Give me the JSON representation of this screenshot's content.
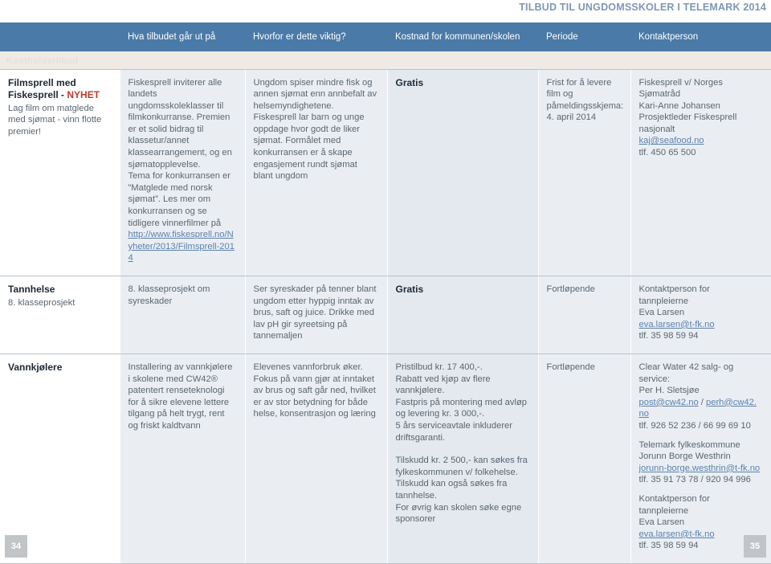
{
  "header": {
    "title": "TILBUD TIL UNGDOMSSKOLER I TELEMARK 2014",
    "accent_color": "#7e96b5"
  },
  "table": {
    "header_bg": "#4a7aa7",
    "band_text": "Kostholdstilbud",
    "columns": [
      {
        "key": "tilbud",
        "label": ""
      },
      {
        "key": "hva",
        "label": "Hva tilbudet går ut på"
      },
      {
        "key": "hvorfor",
        "label": "Hvorfor er dette viktig?"
      },
      {
        "key": "kostnad",
        "label": "Kostnad for kommunen/skolen"
      },
      {
        "key": "periode",
        "label": "Periode"
      },
      {
        "key": "kontaktperson",
        "label": "Kontaktperson"
      }
    ],
    "rows": [
      {
        "title": "Filmsprell med Fiskesprell - ",
        "title_badge": "NYHET",
        "subtitle": "Lag film om matglede med sjømat - vinn flotte premier!",
        "hva": "Fiskesprell inviterer alle landets ungdomsskoleklasser til filmkonkurranse. Premien er et solid bidrag til klassetur/annet klassearrangement, og en sjømatopplevelse.\nTema for konkurransen er ”Matglede med norsk sjømat”. Les mer om konkurransen og se tidligere vinnerfilmer på ",
        "hva_link": "http://www.fiskesprell.no/Nyheter/2013/Filmsprell-2014",
        "hvorfor": "Ungdom spiser mindre fisk og annen sjømat enn annbefalt av helsemyndighetene. Fiskesprell lar barn og unge oppdage hvor godt de liker sjømat. Formålet med konkurransen er å skape engasjement rundt sjømat blant ungdom",
        "kostnad_bold": "Gratis",
        "kostnad": "",
        "periode": "Frist for å levere film og påmeldingsskjema:\n4. april 2014",
        "kontakt_lines": [
          {
            "text": "Fiskesprell v/ Norges Sjømatråd",
            "link": false
          },
          {
            "text": "Kari-Anne Johansen",
            "link": false
          },
          {
            "text": "Prosjektleder Fiskesprell nasjonalt",
            "link": false
          },
          {
            "text": "kaj@seafood.no",
            "link": true
          },
          {
            "text": "tlf. 450 65 500",
            "link": false
          }
        ]
      },
      {
        "title": "Tannhelse",
        "title_badge": "",
        "subtitle": "8. klasseprosjekt",
        "hva": "8. klasseprosjekt om syreskader",
        "hva_link": "",
        "hvorfor": "Ser syreskader på tenner blant ungdom etter hyppig inntak av brus, saft og juice. Drikke med lav pH gir syreetsing på tannemaljen",
        "kostnad_bold": "Gratis",
        "kostnad": "",
        "periode": "Fortløpende",
        "kontakt_lines": [
          {
            "text": "Kontaktperson for tannpleierne",
            "link": false
          },
          {
            "text": "Eva Larsen",
            "link": false
          },
          {
            "text": "eva.larsen@t-fk.no",
            "link": true
          },
          {
            "text": "tlf. 35 98 59 94",
            "link": false
          }
        ]
      },
      {
        "title": "Vannkjølere",
        "title_badge": "",
        "subtitle": "",
        "hva": "Installering av vannkjølere i skolene med CW42® patentert renseteknologi for å sikre elevene lettere tilgang på helt trygt, rent og friskt kaldtvann",
        "hva_link": "",
        "hvorfor": "Elevenes vannforbruk øker. Fokus på vann gjør at inntaket av brus og saft går ned, hvilket er av stor betydning for både helse, konsentrasjon og læring",
        "kostnad_bold": "",
        "kostnad": "Pristilbud kr. 17 400,-.\nRabatt ved kjøp av flere vannkjølere.\nFastpris på montering med avløp og levering kr. 3 000,-.\n5 års serviceavtale inkluderer driftsgaranti.",
        "kostnad2": "Tilskudd kr. 2 500,- kan søkes fra fylkeskommunen v/ folkehelse.\nTilskudd kan også søkes fra tannhelse.\nFor øvrig kan skolen søke egne sponsorer",
        "periode": "Fortløpende",
        "kontakt_lines": [
          {
            "text": "Clear Water 42 salg- og service:",
            "link": false
          },
          {
            "text": "Per H. Sletsjøe",
            "link": false
          },
          {
            "text": "post@cw42.no",
            "link": true,
            "after": " / ",
            "text2": "perh@cw42.no",
            "link2": true
          },
          {
            "text": "tlf. 926 52 236 / 66 99 69 10",
            "link": false
          },
          {
            "text": "",
            "link": false
          },
          {
            "text": "Telemark fylkeskommune",
            "link": false
          },
          {
            "text": "Jorunn Borge Westhrin",
            "link": false
          },
          {
            "text": "jorunn-borge.westhrin@t-fk.no",
            "link": true
          },
          {
            "text": "tlf. 35 91 73 78 / 920 94 996",
            "link": false
          },
          {
            "text": "",
            "link": false
          },
          {
            "text": "Kontaktperson for tannpleierne",
            "link": false
          },
          {
            "text": "Eva Larsen",
            "link": false
          },
          {
            "text": "eva.larsen@t-fk.no",
            "link": true
          },
          {
            "text": "tlf. 35 98 59 94",
            "link": false
          }
        ]
      }
    ]
  },
  "folios": {
    "left": "34",
    "right": "35"
  }
}
